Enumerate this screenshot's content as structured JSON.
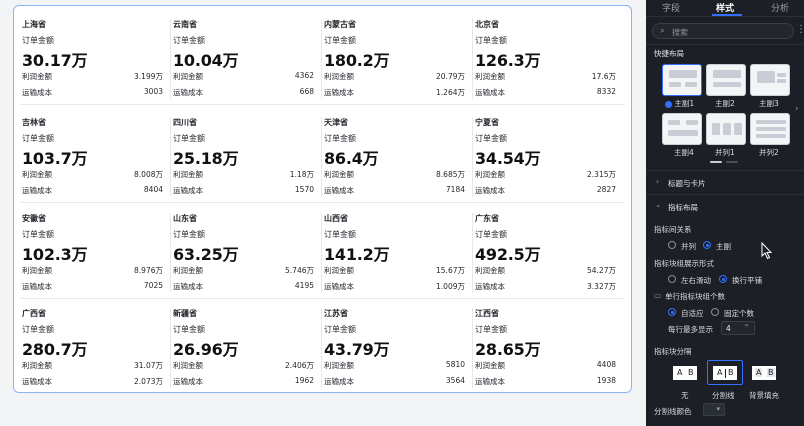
{
  "cards": [
    {
      "title": "上海省",
      "label": "订单金额",
      "value": "30.17万",
      "m1_label": "利润金额",
      "m1_value": "3.199万",
      "m2_label": "运输成本",
      "m2_value": "3003"
    },
    {
      "title": "云南省",
      "label": "订单金额",
      "value": "10.04万",
      "m1_label": "利润金额",
      "m1_value": "4362",
      "m2_label": "运输成本",
      "m2_value": "668"
    },
    {
      "title": "内蒙古省",
      "label": "订单金额",
      "value": "180.2万",
      "m1_label": "利润金额",
      "m1_value": "20.79万",
      "m2_label": "运输成本",
      "m2_value": "1.264万"
    },
    {
      "title": "北京省",
      "label": "订单金额",
      "value": "126.3万",
      "m1_label": "利润金额",
      "m1_value": "17.6万",
      "m2_label": "运输成本",
      "m2_value": "8332"
    },
    {
      "title": "吉林省",
      "label": "订单金额",
      "value": "103.7万",
      "m1_label": "利润金额",
      "m1_value": "8.008万",
      "m2_label": "运输成本",
      "m2_value": "8404"
    },
    {
      "title": "四川省",
      "label": "订单金额",
      "value": "25.18万",
      "m1_label": "利润金额",
      "m1_value": "1.18万",
      "m2_label": "运输成本",
      "m2_value": "1570"
    },
    {
      "title": "天津省",
      "label": "订单金额",
      "value": "86.4万",
      "m1_label": "利润金额",
      "m1_value": "8.685万",
      "m2_label": "运输成本",
      "m2_value": "7184"
    },
    {
      "title": "宁夏省",
      "label": "订单金额",
      "value": "34.54万",
      "m1_label": "利润金额",
      "m1_value": "2.315万",
      "m2_label": "运输成本",
      "m2_value": "2827"
    },
    {
      "title": "安徽省",
      "label": "订单金额",
      "value": "102.3万",
      "m1_label": "利润金额",
      "m1_value": "8.976万",
      "m2_label": "运输成本",
      "m2_value": "7025"
    },
    {
      "title": "山东省",
      "label": "订单金额",
      "value": "63.25万",
      "m1_label": "利润金额",
      "m1_value": "5.746万",
      "m2_label": "运输成本",
      "m2_value": "4195"
    },
    {
      "title": "山西省",
      "label": "订单金额",
      "value": "141.2万",
      "m1_label": "利润金额",
      "m1_value": "15.67万",
      "m2_label": "运输成本",
      "m2_value": "1.009万"
    },
    {
      "title": "广东省",
      "label": "订单金额",
      "value": "492.5万",
      "m1_label": "利润金额",
      "m1_value": "54.27万",
      "m2_label": "运输成本",
      "m2_value": "3.327万"
    },
    {
      "title": "广西省",
      "label": "订单金额",
      "value": "280.7万",
      "m1_label": "利润金额",
      "m1_value": "31.07万",
      "m2_label": "运输成本",
      "m2_value": "2.073万"
    },
    {
      "title": "新疆省",
      "label": "订单金额",
      "value": "26.96万",
      "m1_label": "利润金额",
      "m1_value": "2.406万",
      "m2_label": "运输成本",
      "m2_value": "1962"
    },
    {
      "title": "江苏省",
      "label": "订单金额",
      "value": "43.79万",
      "m1_label": "利润金额",
      "m1_value": "5810",
      "m2_label": "运输成本",
      "m2_value": "3564"
    },
    {
      "title": "江西省",
      "label": "订单金额",
      "value": "28.65万",
      "m1_label": "利润金额",
      "m1_value": "4408",
      "m2_label": "运输成本",
      "m2_value": "1938"
    }
  ],
  "panel": {
    "tabs": [
      "字段",
      "样式",
      "分析"
    ],
    "active_tab": "样式",
    "search_placeholder": "搜索",
    "quick_layout_title": "快捷布局",
    "layouts": [
      "主副1",
      "主副2",
      "主副3",
      "主副4",
      "并列1",
      "并列2"
    ],
    "section_title_card": "标题与卡片",
    "section_metric_layout": "指标布局",
    "relation_label": "指标间关系",
    "relation_opt1": "并列",
    "relation_opt2": "主副",
    "block_display_label": "指标块组展示形式",
    "display_opt1": "左右滑动",
    "display_opt2": "换行平铺",
    "per_row_label": "单行指标块组个数",
    "per_row_opt1": "自适应",
    "per_row_opt2": "固定个数",
    "max_per_row_label": "每行最多显示",
    "max_per_row_value": "4",
    "block_sep_label": "指标块分隔",
    "sep_opt1": "无",
    "sep_opt2": "分割线",
    "sep_opt3": "背景填充",
    "sep_box_a": "A",
    "sep_box_b": "B",
    "sep_color_label": "分割线颜色",
    "accent_color": "#3370ff"
  }
}
